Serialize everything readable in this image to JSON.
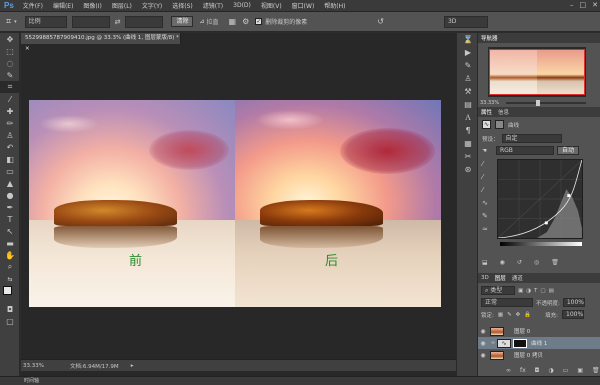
{
  "app": {
    "logo": "Ps"
  },
  "menubar": {
    "items": [
      "文件(F)",
      "编辑(E)",
      "图像(I)",
      "图层(L)",
      "文字(Y)",
      "选择(S)",
      "滤镜(T)",
      "3D(D)",
      "视图(V)",
      "窗口(W)",
      "帮助(H)"
    ]
  },
  "options": {
    "ratio_value": "比例",
    "straighten_label": "拉直",
    "clear_label": "清除",
    "delete_cropped_label": "删除裁剪的像素",
    "workspace": "3D"
  },
  "document": {
    "tab_title": "55299885787909410.jpg @ 33.3% (曲线 1, 图层蒙版/8) *",
    "label_before": "前",
    "label_after": "后"
  },
  "status": {
    "zoom": "33.33%",
    "doc_size": "文档:6.94M/17.9M"
  },
  "timeline": {
    "label": "时间轴"
  },
  "navigator": {
    "tab": "导航器",
    "zoom": "33.33%"
  },
  "properties": {
    "tabs": [
      "属性",
      "信息"
    ],
    "type_label": "曲线",
    "preset_label": "预设：",
    "preset_value": "自定",
    "channel_value": "RGB",
    "auto_label": "自动"
  },
  "layers": {
    "tabs": [
      "3D",
      "图层",
      "通道"
    ],
    "kind_label": "类型",
    "blend_mode": "正常",
    "opacity_label": "不透明度:",
    "opacity_value": "100%",
    "lock_label": "锁定:",
    "fill_label": "填充:",
    "fill_value": "100%",
    "rows": [
      {
        "name": "图层 0"
      },
      {
        "name": "曲线 1"
      },
      {
        "name": "图层 0 拷贝"
      }
    ]
  }
}
